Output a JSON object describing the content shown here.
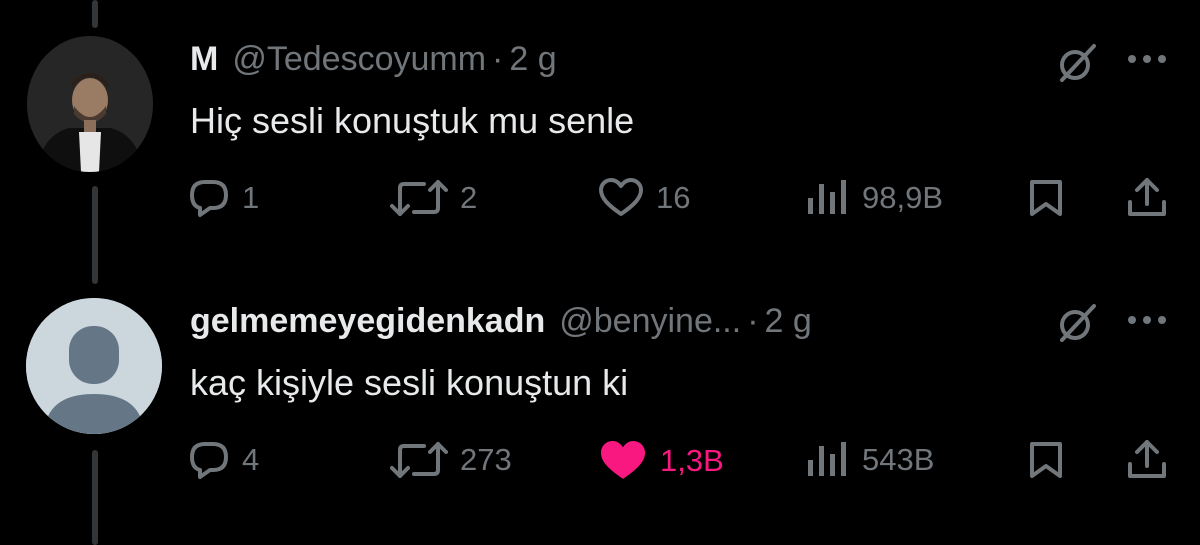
{
  "tweets": [
    {
      "display_name": "M",
      "handle": "@Tedescoyumm",
      "separator": "·",
      "time": "2 g",
      "text": "Hiç sesli konuştuk mu senle",
      "replies": "1",
      "retweets": "2",
      "likes": "16",
      "views": "98,9B",
      "liked": false
    },
    {
      "display_name": "gelmemeyegidenkadn",
      "handle": "@benyine...",
      "separator": "·",
      "time": "2 g",
      "text": "kaç kişiyle sesli konuştun ki",
      "replies": "4",
      "retweets": "273",
      "likes": "1,3B",
      "views": "543B",
      "liked": true
    }
  ],
  "icons": {
    "reply": "reply-icon",
    "retweet": "retweet-icon",
    "like": "heart-icon",
    "views": "views-icon",
    "bookmark": "bookmark-icon",
    "share": "share-icon",
    "grok": "grok-icon",
    "more": "more-icon"
  },
  "colors": {
    "background": "#000000",
    "text": "#e7e9ea",
    "muted": "#71767b",
    "like": "#f91880"
  }
}
